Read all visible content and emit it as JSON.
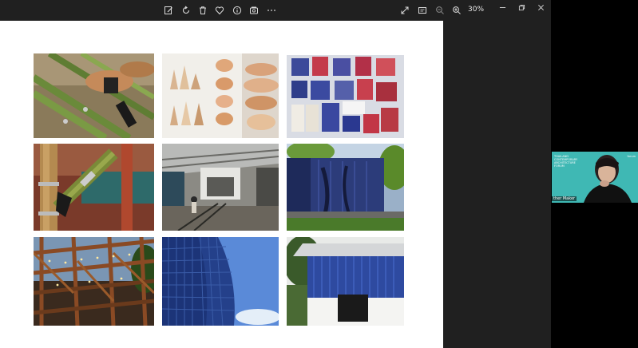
{
  "toolbar": {
    "zoom_level": "30%",
    "buttons": [
      "edit-icon",
      "rotate-icon",
      "delete-icon",
      "favorite-icon",
      "info-icon",
      "gallery-icon",
      "more-icon"
    ],
    "right_buttons": [
      "expand-icon",
      "slideshow-icon",
      "zoom-out-icon",
      "zoom-in-icon"
    ]
  },
  "window_controls": [
    "minimize-icon",
    "restore-icon",
    "close-icon"
  ],
  "colors": {
    "viewer_bg": "#202020",
    "canvas_bg": "#ffffff",
    "webcam_bg": "#3fb8b4"
  },
  "photos": [
    {
      "name": "bamboo-hands",
      "subject": "hands tying bamboo poles"
    },
    {
      "name": "ceramic-cones",
      "subject": "ceramic cones and bowls"
    },
    {
      "name": "blue-red-textiles",
      "subject": "blue and red fabric swatches"
    },
    {
      "name": "bamboo-joint",
      "subject": "bamboo joint with metal clamps"
    },
    {
      "name": "factory-interior",
      "subject": "workshop interior with worker"
    },
    {
      "name": "blue-wall-garden",
      "subject": "blue panel wall in garden"
    },
    {
      "name": "steel-frame-lights",
      "subject": "rusted steel frame with string lights"
    },
    {
      "name": "blue-glass-tower",
      "subject": "curved blue glass building"
    },
    {
      "name": "blue-barn-house",
      "subject": "house with blue cladding"
    }
  ],
  "webcam": {
    "overlay_text": "THAILAND CONTEMPORARY ARCHITECTURE FORUM",
    "logo_text": "forum",
    "participant_name": "ther Maker"
  }
}
